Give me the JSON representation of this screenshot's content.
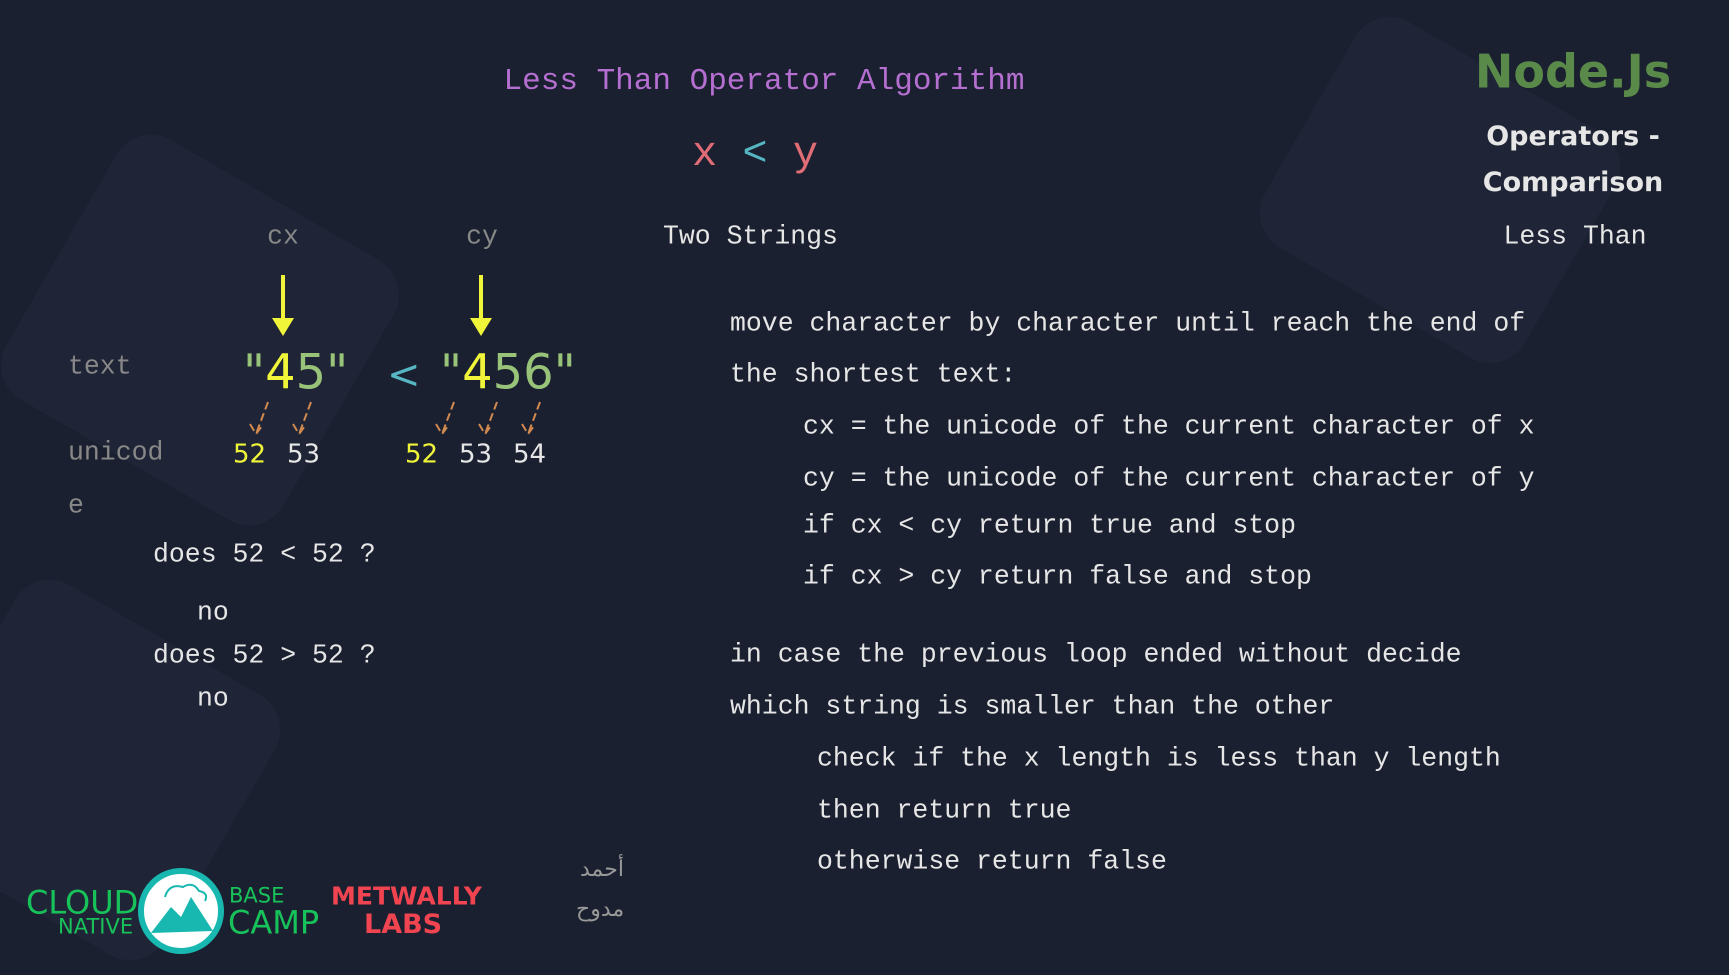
{
  "title": "Less Than Operator Algorithm",
  "expr": {
    "x": "x",
    "op": "<",
    "y": "y"
  },
  "heading": "Two Strings",
  "side": {
    "brand": "Node.Js",
    "topic1": "Operators -",
    "topic2": "Comparison",
    "subtopic": "Less Than"
  },
  "diagram": {
    "cx": "cx",
    "cy": "cy",
    "text_label": "text",
    "unicode_label1": "unicod",
    "unicode_label2": "e",
    "quote": "\"",
    "x_first": "4",
    "x_rest": "5",
    "y_first": "4",
    "y_rest": "56",
    "op": "<",
    "x_codes": [
      "52",
      "53"
    ],
    "y_codes": [
      "52",
      "53",
      "54"
    ],
    "q1": "does 52 < 52 ?",
    "a1": "no",
    "q2": "does 52 > 52 ?",
    "a2": "no"
  },
  "algorithm": {
    "lines": [
      "move character by character until reach the end of",
      "the shortest text:"
    ],
    "inner": [
      "cx = the unicode of the current character of x",
      "cy = the unicode of the current character of y",
      "if cx < cy return true and stop",
      "if cx > cy return false and stop"
    ],
    "lines2": [
      "in case the previous loop ended without decide",
      "which string is smaller than the other"
    ],
    "inner2": [
      "check if the x length is less than y length",
      "then return true",
      "otherwise return false"
    ]
  },
  "logos": {
    "cloud": "CLOUD",
    "native": "NATIVE",
    "base": "BASE",
    "camp": "CAMP",
    "metwally": "METWALLY",
    "labs": "LABS",
    "arabic1": "أحمد",
    "arabic2": "مدوح"
  },
  "colors": {
    "bg": "#1b2030",
    "title": "#b46fd0",
    "red": "#e06c75",
    "cyan": "#56b6c2",
    "yellow": "#f0f53a",
    "green": "#98c379",
    "node": "#5a8a4a"
  }
}
